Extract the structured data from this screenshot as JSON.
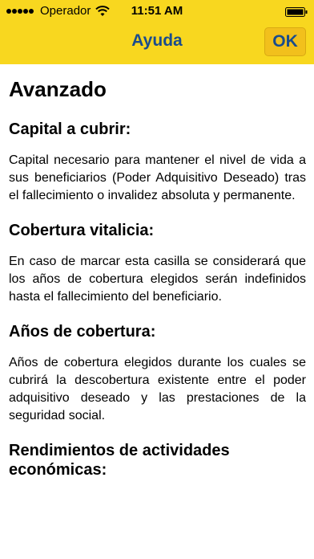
{
  "status_bar": {
    "carrier": "Operador",
    "time": "11:51 AM"
  },
  "nav": {
    "title": "Ayuda",
    "ok_label": "OK"
  },
  "content": {
    "heading": "Avanzado",
    "sections": [
      {
        "title": "Capital a cubrir:",
        "text": "Capital necesario para mantener el nivel de vida a sus beneficiarios (Poder Adquisitivo Deseado) tras el fallecimiento o invalidez absoluta y permanente."
      },
      {
        "title": "Cobertura vitalicia:",
        "text": "En caso de marcar esta casilla se considerará que los años de cobertura elegidos serán indefinidos hasta el fallecimiento del beneficiario."
      },
      {
        "title": "Años de cobertura:",
        "text": "Años de cobertura elegidos durante los cuales se cubrirá la descobertura existente entre el poder adquisitivo deseado y las prestaciones de la seguridad social."
      },
      {
        "title": "Rendimientos de actividades económicas:"
      }
    ]
  },
  "colors": {
    "header_bg": "#f8d71f",
    "title_text": "#1a4c8c",
    "ok_button_bg": "#f2c01c"
  }
}
